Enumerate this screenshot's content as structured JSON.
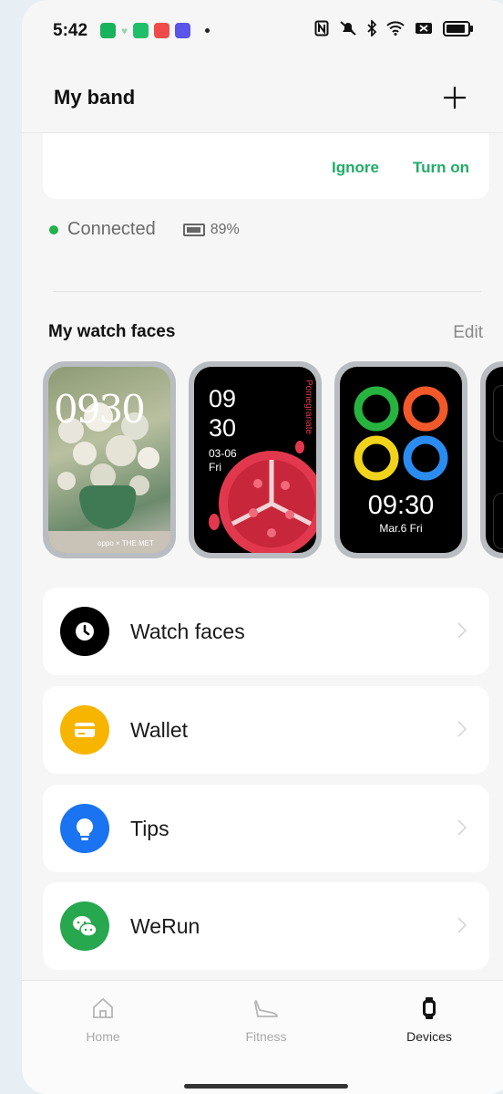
{
  "status_bar": {
    "time": "5:42"
  },
  "header": {
    "title": "My band"
  },
  "notice": {
    "ignore_label": "Ignore",
    "turn_on_label": "Turn on"
  },
  "connection": {
    "status": "Connected",
    "battery": "89%"
  },
  "watch_faces": {
    "title": "My watch faces",
    "edit_label": "Edit",
    "faces": [
      {
        "time": "0930",
        "brand": "oppo × THE MET"
      },
      {
        "hour": "09",
        "minute": "30",
        "date": "03-06",
        "day": "Fri",
        "brand": "Pomegranate"
      },
      {
        "time": "09:30",
        "date": "Mar.6 Fri"
      }
    ]
  },
  "menu": [
    {
      "label": "Watch faces",
      "icon": "clock-icon",
      "color": "#000000"
    },
    {
      "label": "Wallet",
      "icon": "card-icon",
      "color": "#f7b500"
    },
    {
      "label": "Tips",
      "icon": "bulb-icon",
      "color": "#1a73f0"
    },
    {
      "label": "WeRun",
      "icon": "wechat-icon",
      "color": "#27a74e"
    }
  ],
  "nav": [
    {
      "label": "Home",
      "icon": "home-icon"
    },
    {
      "label": "Fitness",
      "icon": "shoe-icon"
    },
    {
      "label": "Devices",
      "icon": "band-icon"
    }
  ],
  "colors": {
    "accent": "#1fad66",
    "connected": "#22b14c"
  }
}
